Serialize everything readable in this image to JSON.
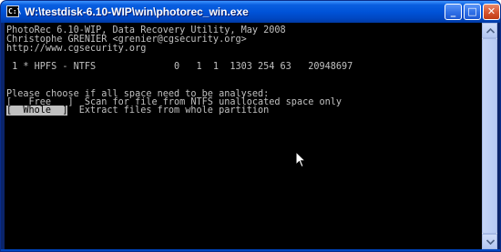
{
  "window": {
    "title": "W:\\testdisk-6.10-WIP\\win\\photorec_win.exe",
    "icon_glyph": "C:\\",
    "buttons": {
      "minimize": "_",
      "maximize": "□",
      "close": "✕"
    }
  },
  "console": {
    "header_line1": "PhotoRec 6.10-WIP, Data Recovery Utility, May 2008",
    "header_line2": "Christophe GRENIER <grenier@cgsecurity.org>",
    "header_line3": "http://www.cgsecurity.org",
    "partition_line": " 1 * HPFS - NTFS              0   1  1  1303 254 63   20948697",
    "prompt": "Please choose if all space need to be analysed:",
    "option_free_label": "[   Free   ]",
    "option_free_desc": "  Scan for file from NTFS unallocated space only",
    "option_whole_label": "[  Whole  ]",
    "option_whole_desc": "  Extract files from whole partition",
    "selected_option": "Whole"
  },
  "icons": {
    "app": "console-app-icon",
    "pointer": "mouse-pointer-icon",
    "scroll_up": "scroll-up-arrow-icon",
    "scroll_down": "scroll-down-arrow-icon"
  },
  "colors": {
    "titlebar": "#0053d8",
    "console_bg": "#000000",
    "console_text": "#c0c0c0",
    "highlight_bg": "#c0c0c0",
    "close_button": "#d6542f"
  }
}
